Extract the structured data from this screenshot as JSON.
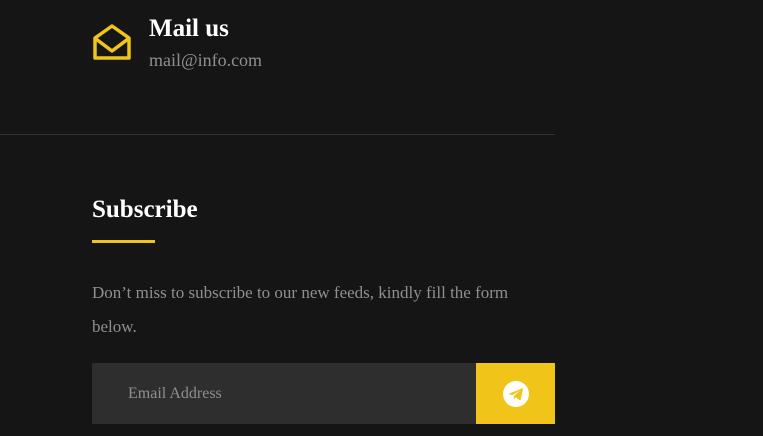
{
  "contact": {
    "mail_icon": "envelope-open-icon",
    "title": "Mail us",
    "address": "mail@info.com"
  },
  "subscribe": {
    "title": "Subscribe",
    "description": "Don’t miss to subscribe to our new feeds, kindly fill the form below.",
    "email_placeholder": "Email Address",
    "email_value": "",
    "submit_icon": "telegram-send-icon"
  },
  "colors": {
    "background": "#151515",
    "accent": "#f0c419",
    "input_background": "#2e2e2e",
    "muted_text": "#8f8f8f",
    "divider": "#333333"
  }
}
